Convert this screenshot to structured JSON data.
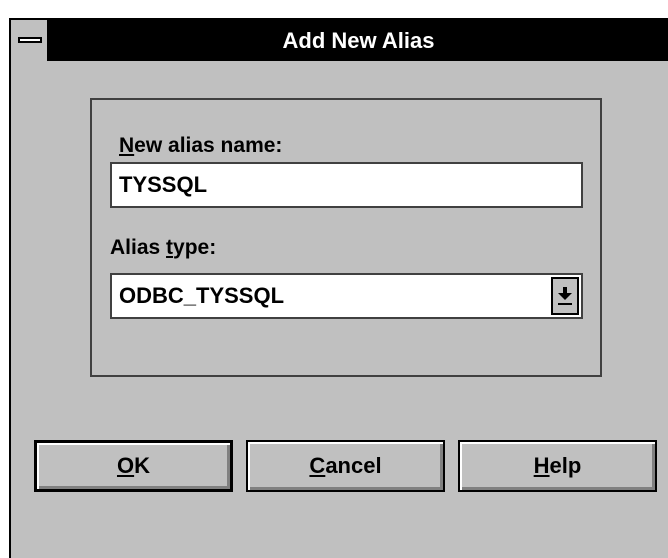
{
  "window": {
    "title": "Add New Alias",
    "system_menu_icon": "system-menu-icon",
    "colors": {
      "face": "#c0c0c0",
      "titlebar": "#000000",
      "title_text": "#ffffff"
    }
  },
  "form": {
    "alias_name": {
      "label_key": "N",
      "label_rest": "ew alias name:",
      "value": "TYSSQL"
    },
    "alias_type": {
      "label_pre": "Alias ",
      "label_key": "t",
      "label_rest": "ype:",
      "value": "ODBC_TYSSQL",
      "dropdown_icon": "dropdown-arrow-icon"
    }
  },
  "buttons": {
    "ok": {
      "key": "O",
      "rest": "K"
    },
    "cancel": {
      "key": "C",
      "rest": "ancel"
    },
    "help": {
      "key": "H",
      "rest": "elp"
    }
  }
}
